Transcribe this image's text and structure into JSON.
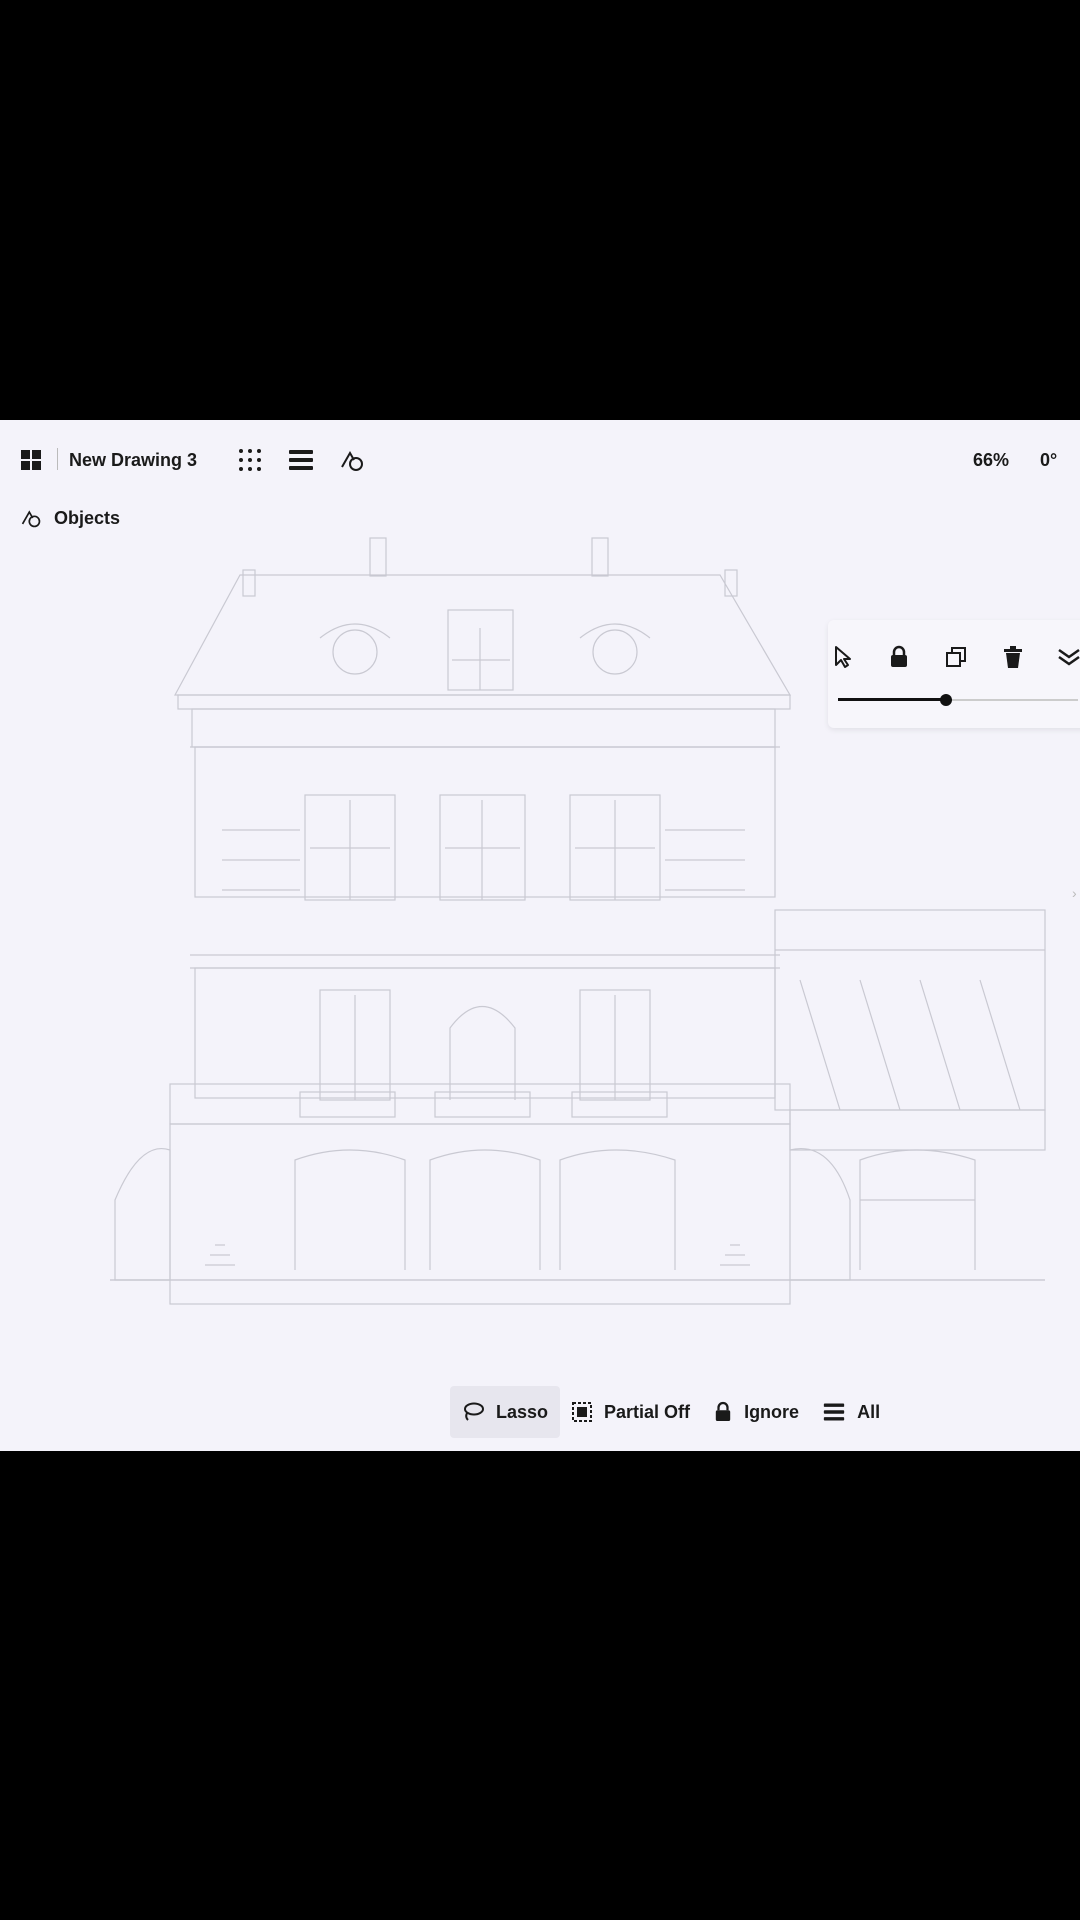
{
  "document": {
    "title": "New Drawing 3",
    "zoom": "66%",
    "rotation": "0°"
  },
  "toolbar": {
    "gallery_icon": "gallery-grid-icon",
    "grid_icon": "dot-grid-icon",
    "layers_icon": "layers-icon",
    "shapes_icon": "shapes-icon"
  },
  "panel": {
    "objects_label": "Objects",
    "objects_icon": "shapes-icon"
  },
  "selection_panel": {
    "icons": [
      "cursor-icon",
      "lock-icon",
      "duplicate-icon",
      "trash-icon",
      "collapse-icon"
    ],
    "slider_value": 0.45
  },
  "bottom_bar": {
    "lasso": "Lasso",
    "partial": "Partial Off",
    "ignore": "Ignore",
    "all": "All"
  },
  "colors": {
    "background": "#f4f3fa",
    "ink": "#1a1a1a",
    "drawing_lines": "#c9c9d2"
  }
}
